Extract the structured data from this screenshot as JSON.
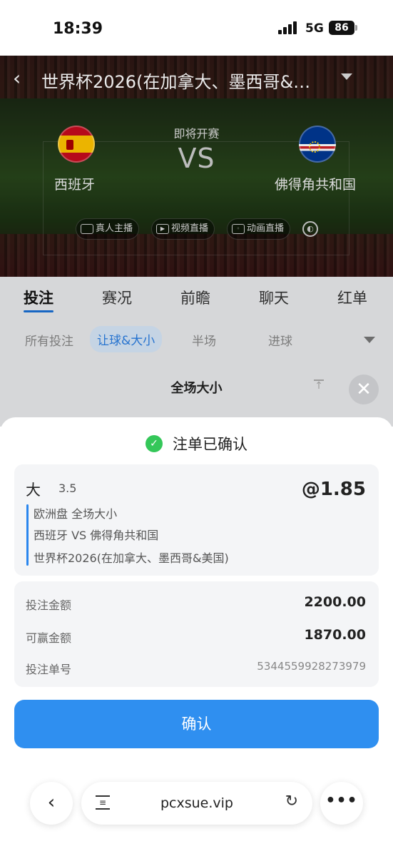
{
  "status_bar": {
    "time": "18:39",
    "network": "5G",
    "battery": "86"
  },
  "match": {
    "title": "世界杯2026(在加拿大、墨西哥&…",
    "status": "即将开赛",
    "vs": "VS",
    "home_team": "西班牙",
    "away_team": "佛得角共和国",
    "media": [
      "真人主播",
      "视频直播",
      "动画直播"
    ]
  },
  "tabs": [
    "投注",
    "赛况",
    "前瞻",
    "聊天",
    "红单"
  ],
  "sub_tabs": [
    "所有投注",
    "让球&大小",
    "半场",
    "进球"
  ],
  "section_title": "全场大小",
  "sheet": {
    "header": "注单已确认",
    "pick": "大",
    "line": "3.5",
    "odds": "@1.85",
    "market": "欧洲盘 全场大小",
    "matchup": "西班牙 VS 佛得角共和国",
    "league": "世界杯2026(在加拿大、墨西哥&美国)",
    "stake_label": "投注金额",
    "stake": "2200.00",
    "win_label": "可赢金额",
    "win": "1870.00",
    "ticket_label": "投注单号",
    "ticket": "5344559928273979",
    "confirm": "确认"
  },
  "browser": {
    "url": "pcxsue.vip"
  },
  "colors": {
    "accent": "#2f8ff0",
    "success": "#34c759",
    "tab_active": "#1a6fd4"
  }
}
